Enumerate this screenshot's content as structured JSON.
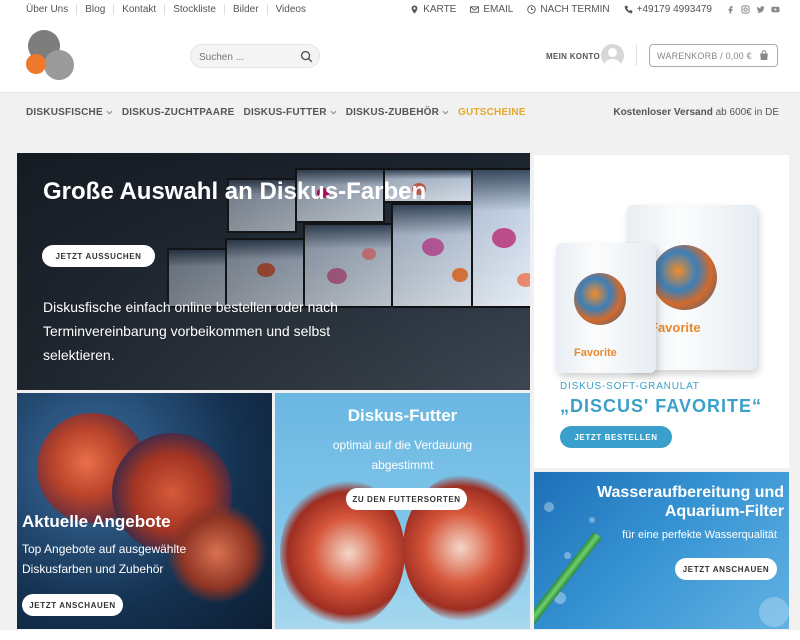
{
  "topbar": {
    "links": [
      "Über Uns",
      "Blog",
      "Kontakt",
      "Stockliste",
      "Bilder",
      "Videos"
    ],
    "karte": "KARTE",
    "email": "EMAIL",
    "termin": "NACH TERMIN",
    "phone": "+49179 4993479"
  },
  "header": {
    "search_placeholder": "Suchen ...",
    "account": "MEIN KONTO",
    "cart": "WARENKORB / 0,00 €"
  },
  "nav": {
    "items": [
      "DISKUSFISCHE",
      "DISKUS-ZUCHTPAARE",
      "DISKUS-FUTTER",
      "DISKUS-ZUBEHÖR",
      "GUTSCHEINE"
    ],
    "shipping_bold": "Kostenloser Versand",
    "shipping_rest": " ab 600€ in DE"
  },
  "banners": {
    "main": {
      "title": "Große Auswahl an Diskus-Farben",
      "button": "JETZT AUSSUCHEN",
      "text": "Diskusfische einfach online bestellen oder nach Terminvereinbarung vorbeikommen und selbst selektieren."
    },
    "food_pack": {
      "caption": "DISKUS-SOFT-GRANULAT",
      "name": "„DISCUS' FAVORITE“",
      "button": "JETZT BESTELLEN",
      "pack_label": "Favorite"
    },
    "offers": {
      "title": "Aktuelle Angebote",
      "text": "Top Angebote auf ausgewählte Diskusfarben und Zubehör",
      "button": "JETZT ANSCHAUEN"
    },
    "futter": {
      "title": "Diskus-Futter",
      "text": "optimal auf die Verdauung abgestimmt",
      "button": "ZU DEN FUTTERSORTEN"
    },
    "water": {
      "title": "Wasseraufbereitung und Aquarium-Filter",
      "text": "für eine perfekte Wasserqualität",
      "button": "JETZT ANSCHAUEN"
    }
  },
  "colors": {
    "accent_blue": "#3a9fca",
    "accent_gold": "#e4a82b",
    "logo_orange": "#f0782a"
  }
}
